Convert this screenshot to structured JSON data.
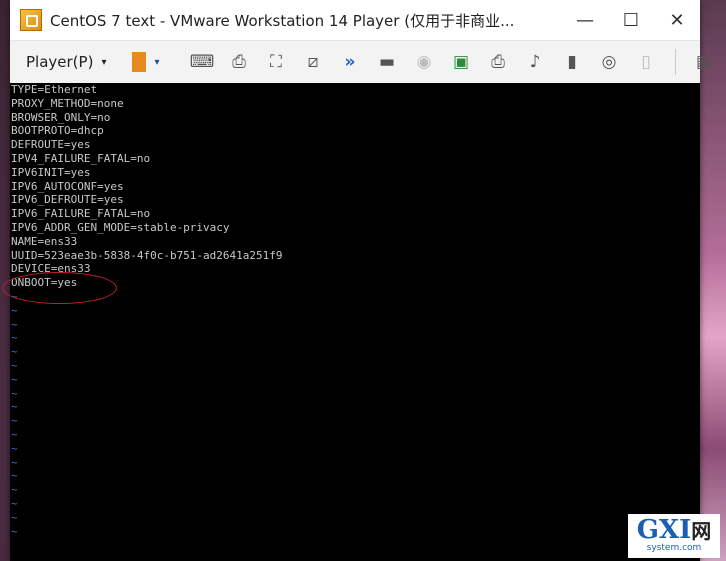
{
  "window": {
    "title": "CentOS 7 text - VMware Workstation 14 Player (仅用于非商业...",
    "minimize_glyph": "—",
    "maximize_glyph": "☐",
    "close_glyph": "✕"
  },
  "toolbar": {
    "player_menu_label": "Player(P)",
    "caret": "▾",
    "pause_caret": "▾",
    "icons": [
      {
        "name": "send-ctrl-alt-del-icon",
        "glyph": "⌨",
        "style": ""
      },
      {
        "name": "removable-devices-icon",
        "glyph": "⎙",
        "style": ""
      },
      {
        "name": "full-screen-icon",
        "glyph": "⛶",
        "style": ""
      },
      {
        "name": "unity-icon",
        "glyph": "⧄",
        "style": ""
      },
      {
        "name": "more-devices-icon",
        "glyph": "»",
        "style": "blue"
      },
      {
        "name": "hard-disk-icon",
        "glyph": "▬",
        "style": ""
      },
      {
        "name": "cd-dvd-icon",
        "glyph": "◉",
        "style": "faded"
      },
      {
        "name": "network-adapter-icon",
        "glyph": "▣",
        "style": "green"
      },
      {
        "name": "printer-icon",
        "glyph": "⎙",
        "style": ""
      },
      {
        "name": "sound-card-icon",
        "glyph": "♪",
        "style": ""
      },
      {
        "name": "usb-device-icon",
        "glyph": "▮",
        "style": ""
      },
      {
        "name": "webcam-icon",
        "glyph": "◎",
        "style": ""
      },
      {
        "name": "display-icon",
        "glyph": "▯",
        "style": "faded"
      },
      {
        "name": "message-log-icon",
        "glyph": "▤",
        "style": ""
      }
    ]
  },
  "terminal": {
    "lines": [
      "TYPE=Ethernet",
      "PROXY_METHOD=none",
      "BROWSER_ONLY=no",
      "BOOTPROTO=dhcp",
      "DEFROUTE=yes",
      "IPV4_FAILURE_FATAL=no",
      "IPV6INIT=yes",
      "IPV6_AUTOCONF=yes",
      "IPV6_DEFROUTE=yes",
      "IPV6_FAILURE_FATAL=no",
      "IPV6_ADDR_GEN_MODE=stable-privacy",
      "NAME=ens33",
      "UUID=523eae3b-5838-4f0c-b751-ad2641a251f9",
      "DEVICE=ens33",
      "ONBOOT=yes"
    ],
    "tilde_glyph": "~",
    "tilde_count": 18
  },
  "watermark": {
    "main": "GXI",
    "cn": "网",
    "sub": "system.com"
  },
  "colors": {
    "terminal_text": "#c8c8c8",
    "tilde": "#3a6ee0",
    "highlight_circle": "#c0202a",
    "pause_orange": "#e68a1e"
  }
}
